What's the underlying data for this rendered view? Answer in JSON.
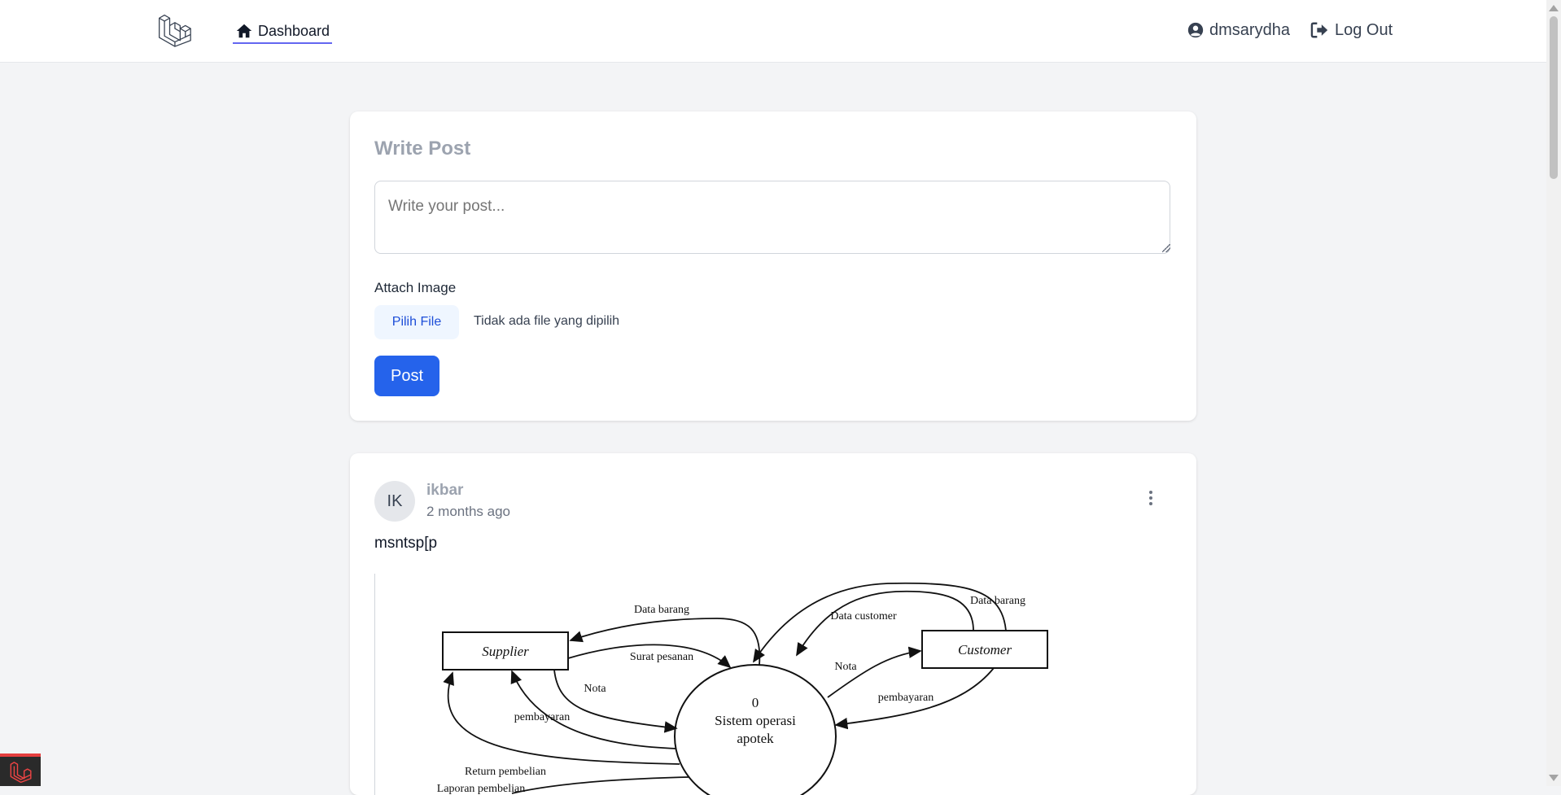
{
  "nav": {
    "dashboard_label": "Dashboard",
    "username": "dmsarydha",
    "logout_label": "Log Out"
  },
  "composer": {
    "title": "Write Post",
    "textarea_placeholder": "Write your post...",
    "attach_label": "Attach Image",
    "file_button_label": "Pilih File",
    "file_status": "Tidak ada file yang dipilih",
    "post_button_label": "Post"
  },
  "feed": [
    {
      "avatar_initials": "IK",
      "author": "ikbar",
      "time": "2 months ago",
      "body": "msntsp[p",
      "image": {
        "entities": [
          "Supplier",
          "Customer"
        ],
        "process_number": "0",
        "process_label_line1": "Sistem operasi",
        "process_label_line2": "apotek",
        "flows": [
          "Data barang",
          "Surat pesanan",
          "Nota",
          "pembayaran",
          "Return pembelian",
          "Laporan pembelian",
          "Data customer",
          "Data barang",
          "Nota",
          "pembayaran"
        ]
      }
    }
  ],
  "colors": {
    "page_bg": "#f3f4f6",
    "primary": "#2563eb",
    "nav_underline": "#6366f1",
    "muted": "#9ca3af"
  }
}
